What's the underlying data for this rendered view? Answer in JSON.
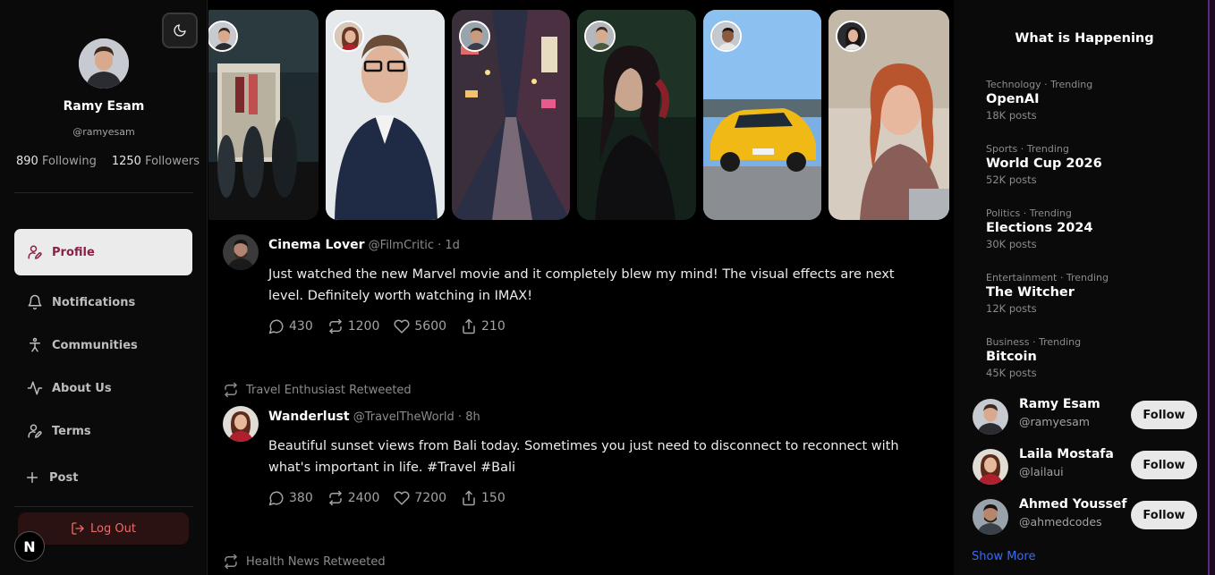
{
  "profile": {
    "name": "Ramy Esam",
    "handle": "@ramyesam",
    "following_count": "890",
    "following_label": "Following",
    "followers_count": "1250",
    "followers_label": "Followers"
  },
  "nav": {
    "profile": "Profile",
    "notifications": "Notifications",
    "communities": "Communities",
    "about": "About Us",
    "terms": "Terms",
    "post": "Post",
    "logout": "Log Out"
  },
  "badge_letter": "N",
  "stories": [
    {
      "icon": "storefront-photo"
    },
    {
      "icon": "portrait-photo"
    },
    {
      "icon": "city-street-photo"
    },
    {
      "icon": "woman-portrait-photo"
    },
    {
      "icon": "sports-car-photo"
    },
    {
      "icon": "woman-laptop-photo"
    }
  ],
  "posts": [
    {
      "name": "Cinema Lover",
      "handle": "@FilmCritic",
      "time": "1d",
      "text": "Just watched the new Marvel movie and it completely blew my mind! The visual effects are next level. Definitely worth watching in IMAX!",
      "replies": "430",
      "retweets": "1200",
      "likes": "5600",
      "shares": "210"
    },
    {
      "retweeted_by": "Travel Enthusiast Retweeted",
      "name": "Wanderlust",
      "handle": "@TravelTheWorld",
      "time": "8h",
      "text": "Beautiful sunset views from Bali today. Sometimes you just need to disconnect to reconnect with what's important in life. #Travel #Bali",
      "replies": "380",
      "retweets": "2400",
      "likes": "7200",
      "shares": "150"
    },
    {
      "retweeted_by": "Health News Retweeted"
    }
  ],
  "trending": {
    "title": "What is Happening",
    "items": [
      {
        "category": "Technology · Trending",
        "topic": "OpenAI",
        "count": "18K posts"
      },
      {
        "category": "Sports · Trending",
        "topic": "World Cup 2026",
        "count": "52K posts"
      },
      {
        "category": "Politics · Trending",
        "topic": "Elections 2024",
        "count": "30K posts"
      },
      {
        "category": "Entertainment · Trending",
        "topic": "The Witcher",
        "count": "12K posts"
      },
      {
        "category": "Business · Trending",
        "topic": "Bitcoin",
        "count": "45K posts"
      }
    ]
  },
  "suggestions": {
    "follow_label": "Follow",
    "show_more": "Show More",
    "users": [
      {
        "name": "Ramy Esam",
        "handle": "@ramyesam"
      },
      {
        "name": "Laila Mostafa",
        "handle": "@lailaui"
      },
      {
        "name": "Ahmed Youssef",
        "handle": "@ahmedcodes"
      }
    ]
  },
  "colors": {
    "accent": "#8a1f47",
    "logout": "#f06a6a",
    "link": "#3b6cf0",
    "background": "#000000"
  }
}
